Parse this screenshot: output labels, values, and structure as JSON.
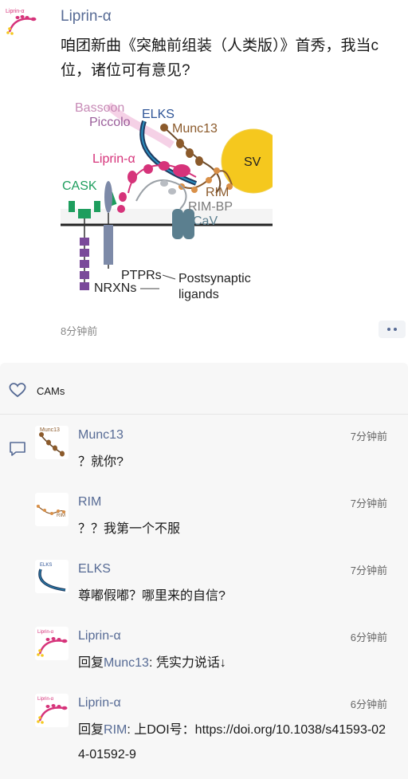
{
  "post": {
    "author": "Liprin-α",
    "avatar_label": "Liprin-α",
    "text": "咱团新曲《突触前组装（人类版）》首秀，我当c位，诸位可有意见?",
    "time": "8分钟前",
    "figure": {
      "labels": {
        "bassoon": "Bassoon",
        "piccolo": "Piccolo",
        "elks": "ELKS",
        "munc13": "Munc13",
        "sv": "SV",
        "liprin": "Liprin-α",
        "cask": "CASK",
        "rim": "RIM",
        "rimbp": "RIM-BP",
        "cav": "CaV",
        "ptprs": "PTPRs",
        "nrxns": "NRXNs",
        "postsynaptic": "Postsynaptic",
        "ligands": "ligands"
      }
    }
  },
  "likes": {
    "names": "CAMs"
  },
  "comments": [
    {
      "author": "Munc13",
      "avatar_label": "Munc13",
      "time": "7分钟前",
      "text": "？就你?"
    },
    {
      "author": "RIM",
      "avatar_label": "RIM",
      "time": "7分钟前",
      "text": "？？我第一个不服"
    },
    {
      "author": "ELKS",
      "avatar_label": "ELKS",
      "time": "7分钟前",
      "text": "尊嘟假嘟？哪里来的自信?"
    },
    {
      "author": "Liprin-α",
      "avatar_label": "Liprin-α",
      "time": "6分钟前",
      "reply_prefix": "回复",
      "reply_to": "Munc13",
      "text": ": 凭实力说话↓"
    },
    {
      "author": "Liprin-α",
      "avatar_label": "Liprin-α",
      "time": "6分钟前",
      "reply_prefix": "回复",
      "reply_to": "RIM",
      "text": ": 上DOI号：https://doi.org/10.1038/s41593-024-01592-9"
    }
  ],
  "colors": {
    "link": "#576b95",
    "liprin": "#d6337a",
    "cask": "#1e9e5e",
    "munc13": "#8b5a2b",
    "sv": "#f5c81e",
    "elks": "#1f3a5f",
    "neurexin": "#7a4a9a",
    "ptpr": "#7d8aa8"
  }
}
